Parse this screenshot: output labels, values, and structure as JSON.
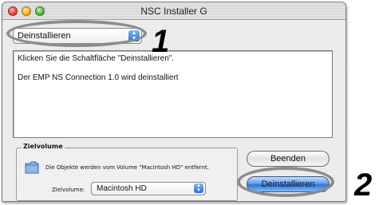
{
  "window": {
    "title": "NSC Installer G"
  },
  "action_popup": {
    "selected": "Deinstallieren"
  },
  "info_text": {
    "line1": "Klicken Sie die Schaltfläche \"Deinstallieren\".",
    "line2": "Der EMP NS Connection 1.0 wird deinstalliert"
  },
  "target_volume": {
    "label": "Zielvolume",
    "message": "Die Objekte werden vom Volume \"Macintosh HD\" entfernt.",
    "field_label": "Zielvolume:",
    "selected": "Macintosh HD"
  },
  "buttons": {
    "quit": "Beenden",
    "uninstall": "Deinstallieren"
  },
  "callouts": {
    "step1": "1",
    "step2": "2"
  },
  "colors": {
    "default_button": "#2f73d4",
    "highlight_ring": "#8c8c8c"
  },
  "icons": {
    "folder": "folder-icon",
    "popup_arrows": "popup-arrows-icon"
  }
}
